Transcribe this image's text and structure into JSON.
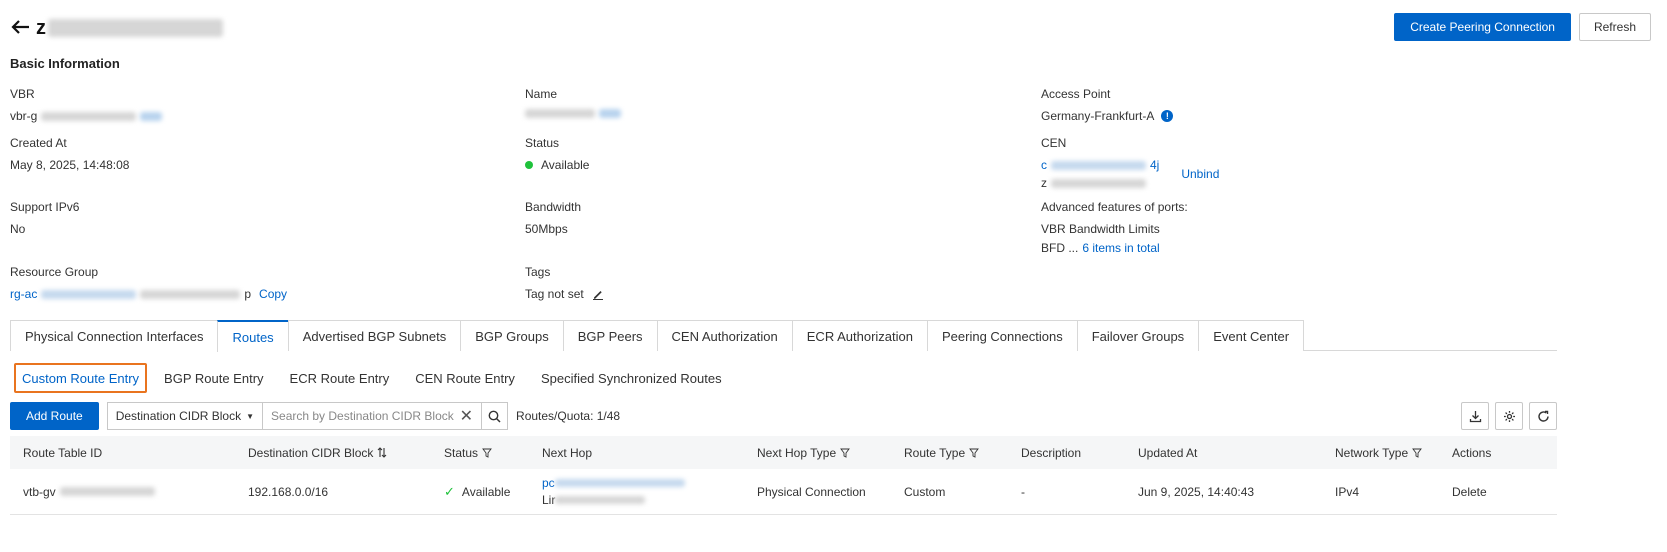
{
  "header": {
    "title_prefix": "z",
    "create_label": "Create Peering Connection",
    "refresh_label": "Refresh"
  },
  "basic": {
    "section_title": "Basic Information",
    "vbr": {
      "label": "VBR",
      "value": "vbr-g"
    },
    "name": {
      "label": "Name"
    },
    "access_point": {
      "label": "Access Point",
      "value": "Germany-Frankfurt-A"
    },
    "created": {
      "label": "Created At",
      "value": "May 8, 2025, 14:48:08"
    },
    "status": {
      "label": "Status",
      "value": "Available"
    },
    "cen": {
      "label": "CEN",
      "value1_prefix": "c",
      "value1_suffix": "4j",
      "value2_prefix": "z",
      "unbind": "Unbind"
    },
    "ipv6": {
      "label": "Support IPv6",
      "value": "No"
    },
    "bandwidth": {
      "label": "Bandwidth",
      "value": "50Mbps"
    },
    "advanced": {
      "label": "Advanced features of ports:",
      "line1": "VBR Bandwidth Limits",
      "line2": "BFD ...",
      "more": "6 items in total"
    },
    "resource_group": {
      "label": "Resource Group",
      "value_prefix": "rg-ac",
      "value_suffix": "p",
      "copy": "Copy"
    },
    "tags": {
      "label": "Tags",
      "value": "Tag not set"
    }
  },
  "tabs": [
    "Physical Connection Interfaces",
    "Routes",
    "Advertised BGP Subnets",
    "BGP Groups",
    "BGP Peers",
    "CEN Authorization",
    "ECR Authorization",
    "Peering Connections",
    "Failover Groups",
    "Event Center"
  ],
  "subtabs": [
    "Custom Route Entry",
    "BGP Route Entry",
    "ECR Route Entry",
    "CEN Route Entry",
    "Specified Synchronized Routes"
  ],
  "toolbar": {
    "add_label": "Add Route",
    "filter_select": "Destination CIDR Block",
    "search_placeholder": "Search by Destination CIDR Block",
    "quota": "Routes/Quota: 1/48"
  },
  "table": {
    "columns": [
      "Route Table ID",
      "Destination CIDR Block",
      "Status",
      "Next Hop",
      "Next Hop Type",
      "Route Type",
      "Description",
      "Updated At",
      "Network Type",
      "Actions"
    ],
    "row": {
      "route_table_prefix": "vtb-gv",
      "cidr": "192.168.0.0/16",
      "status": "Available",
      "next_hop_prefix1": "pc",
      "next_hop_prefix2": "Lir",
      "next_hop_type": "Physical Connection",
      "route_type": "Custom",
      "description": "-",
      "updated": "Jun 9, 2025, 14:40:43",
      "network_type": "IPv4",
      "action": "Delete"
    }
  },
  "colors": {
    "primary": "#0064c8",
    "highlight_border": "#e9741f",
    "success": "#1fc23b"
  }
}
